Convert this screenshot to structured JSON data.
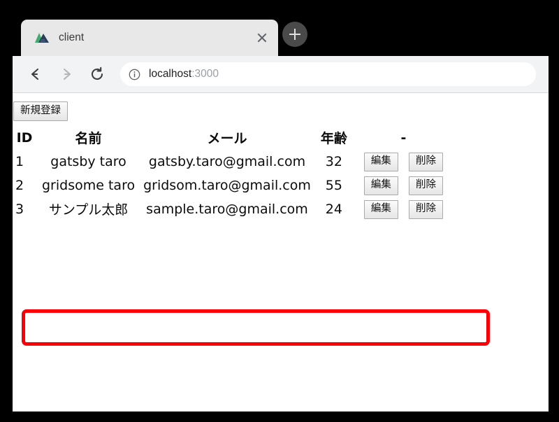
{
  "browser": {
    "tab": {
      "title": "client",
      "favicon_name": "gatsby-mountain-favicon",
      "close_label": "×"
    },
    "new_tab_label": "+",
    "toolbar": {
      "back_label": "←",
      "forward_label": "→",
      "reload_label": "↻",
      "url_main": "localhost",
      "url_port": ":3000",
      "url_full": "localhost:3000",
      "info_icon_label": "ⓘ"
    }
  },
  "page": {
    "new_register_button": "新規登録",
    "table": {
      "headers": [
        "ID",
        "名前",
        "メール",
        "年齢",
        "-"
      ],
      "rows": [
        {
          "id": "1",
          "name": "gatsby taro",
          "email": "gatsby.taro@gmail.com",
          "age": "32",
          "edit": "編集",
          "delete": "削除"
        },
        {
          "id": "2",
          "name": "gridsome taro",
          "email": "gridsom.taro@gmail.com",
          "age": "55",
          "edit": "編集",
          "delete": "削除"
        },
        {
          "id": "3",
          "name": "サンプル太郎",
          "email": "sample.taro@gmail.com",
          "age": "24",
          "edit": "編集",
          "delete": "削除"
        }
      ]
    }
  },
  "annotation": {
    "highlight_color": "#fb0007",
    "highlighted_row_id": "3"
  },
  "colors": {
    "frame": "#000000",
    "tabstrip": "#000000",
    "tab_background": "#e8e8e8",
    "toolbar": "#f1f3f4",
    "page_background": "#ffffff",
    "url_dim": "#9aa0a6",
    "favicon_green": "#3fab6e",
    "favicon_navy": "#2d3c5a"
  }
}
